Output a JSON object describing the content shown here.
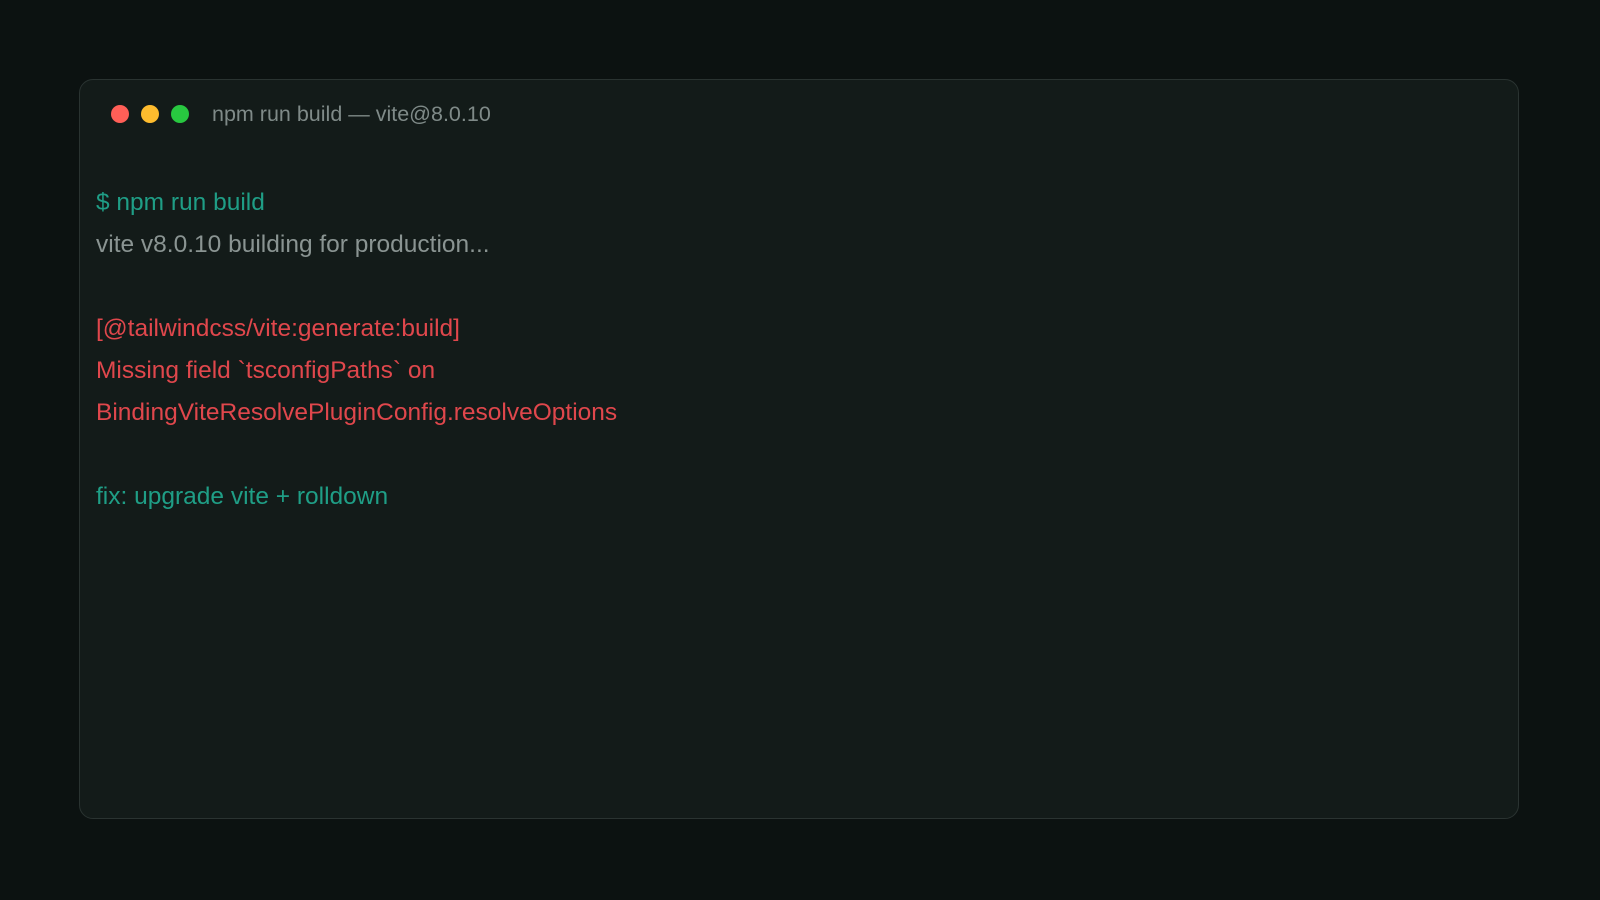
{
  "window": {
    "title": "npm run build — vite@8.0.10",
    "controls": [
      {
        "name": "close",
        "color": "#ff5f57"
      },
      {
        "name": "minimize",
        "color": "#febc2e"
      },
      {
        "name": "maximize",
        "color": "#28c840"
      }
    ]
  },
  "terminal": {
    "lines": [
      {
        "kind": "command",
        "text": "$ npm run build",
        "color": "#1f9e86"
      },
      {
        "kind": "info",
        "text": "vite v8.0.10 building for production...",
        "color": "#8a9492"
      },
      {
        "kind": "blank",
        "text": ""
      },
      {
        "kind": "error",
        "text": "[@tailwindcss/vite:generate:build]",
        "color": "#e0474c"
      },
      {
        "kind": "error",
        "text": "Missing field `tsconfigPaths` on",
        "color": "#e0474c"
      },
      {
        "kind": "error",
        "text": "BindingViteResolvePluginConfig.resolveOptions",
        "color": "#e0474c"
      },
      {
        "kind": "blank",
        "text": ""
      },
      {
        "kind": "hint",
        "text": "fix: upgrade vite + rolldown",
        "color": "#1f9e86"
      }
    ]
  },
  "colors": {
    "page_background": "#0c1211",
    "window_background": "#131b19",
    "window_border": "#2a3331",
    "accent_teal": "#1f9e86",
    "error_red": "#e0474c",
    "muted_text": "#8a9492"
  }
}
